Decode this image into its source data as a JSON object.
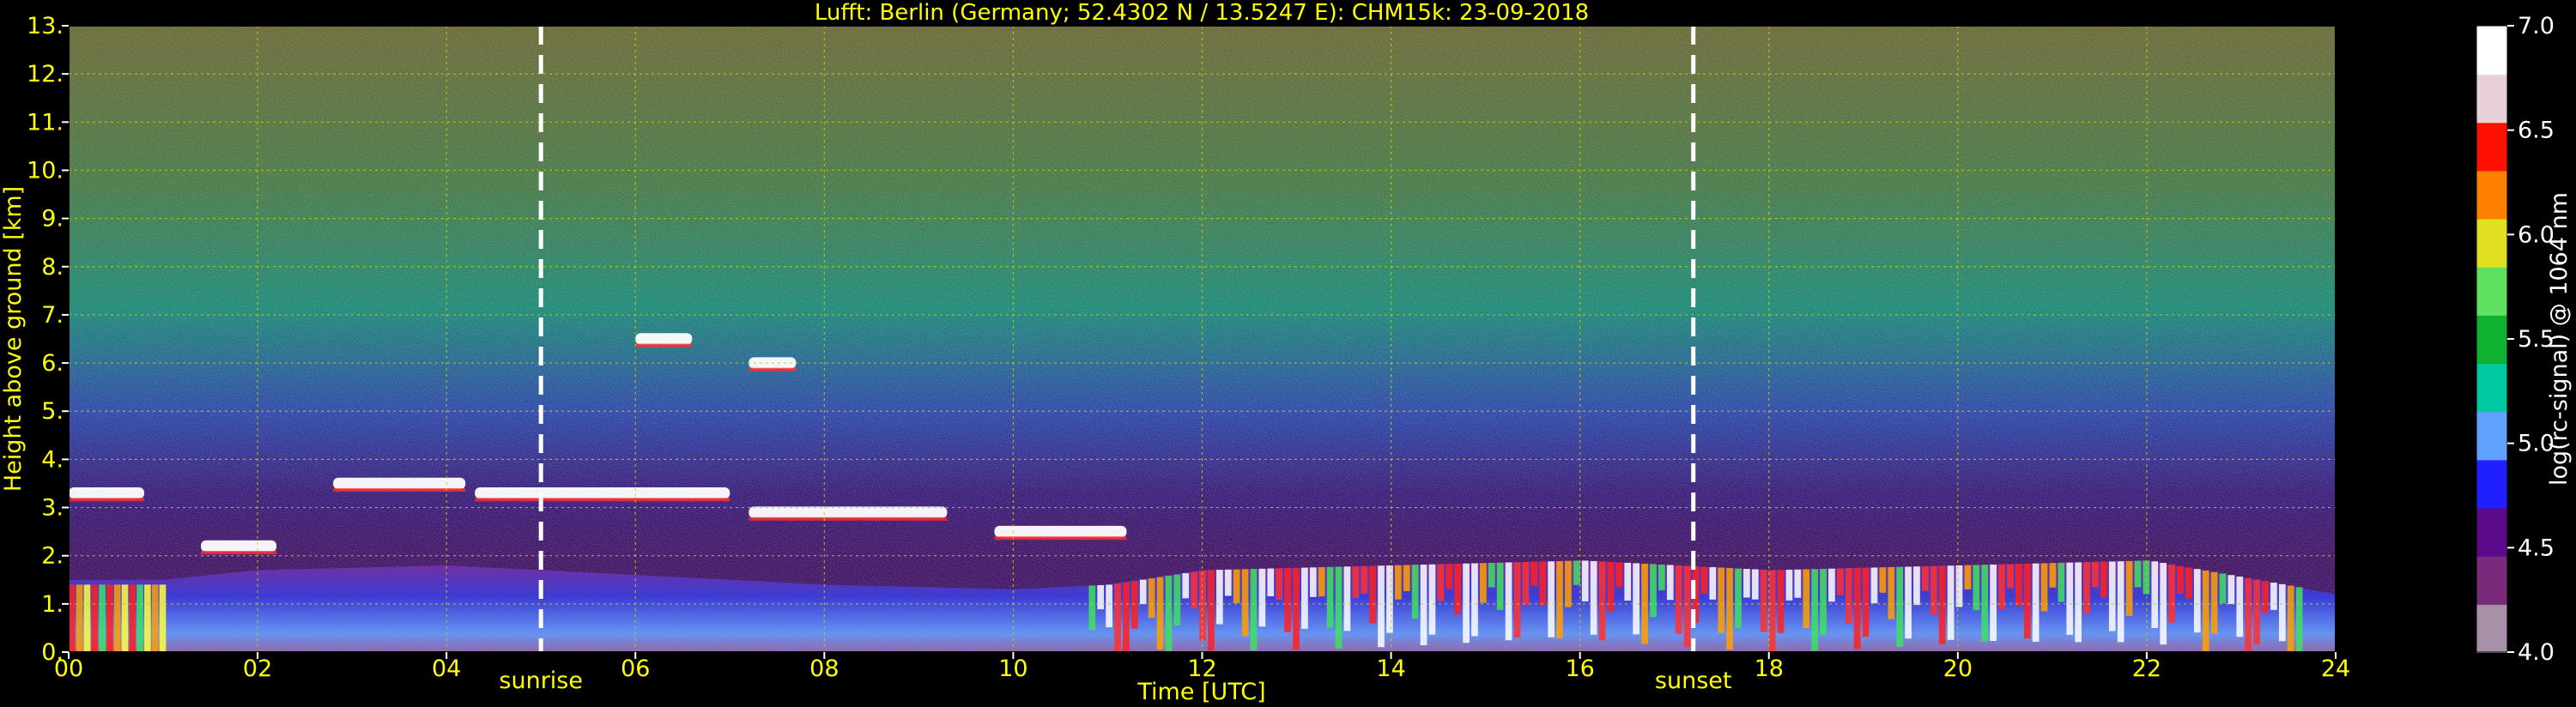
{
  "chart_data": {
    "type": "heatmap",
    "title": "Lufft: Berlin (Germany; 52.4302 N / 13.5247 E):    CHM15k: 23-09-2018",
    "xlabel": "Time [UTC]",
    "ylabel": "Height above ground [km]",
    "xlim": [
      0,
      24
    ],
    "ylim": [
      0,
      13
    ],
    "x_ticks": [
      "00",
      "02",
      "04",
      "06",
      "08",
      "10",
      "12",
      "14",
      "16",
      "18",
      "20",
      "22",
      "24"
    ],
    "y_ticks": [
      "0.",
      "1.",
      "2.",
      "3.",
      "4.",
      "5.",
      "6.",
      "7.",
      "8.",
      "9.",
      "10.",
      "11.",
      "12.",
      "13."
    ],
    "grid": true,
    "colorbar": {
      "label": "log(rc-signal) @ 1064 nm",
      "range": [
        4.0,
        7.0
      ],
      "ticks": [
        "4.0",
        "4.5",
        "5.0",
        "5.5",
        "6.0",
        "6.5",
        "7.0"
      ],
      "colors": [
        "#a890a8",
        "#7a2a7a",
        "#5a0a8a",
        "#2020ff",
        "#60a0ff",
        "#00c8a0",
        "#10b030",
        "#60e060",
        "#e0e020",
        "#ff8000",
        "#ff1000",
        "#e8d0d8",
        "#ffffff"
      ]
    },
    "annotations": [
      {
        "text": "sunrise",
        "x": 5.0
      },
      {
        "text": "sunset",
        "x": 17.2
      }
    ],
    "boundary_layer_top_km": [
      {
        "x": 0.0,
        "y": 1.5
      },
      {
        "x": 1.0,
        "y": 1.5
      },
      {
        "x": 2.0,
        "y": 1.7
      },
      {
        "x": 4.0,
        "y": 1.8
      },
      {
        "x": 6.0,
        "y": 1.6
      },
      {
        "x": 8.0,
        "y": 1.4
      },
      {
        "x": 10.0,
        "y": 1.3
      },
      {
        "x": 11.0,
        "y": 1.4
      },
      {
        "x": 12.0,
        "y": 1.7
      },
      {
        "x": 14.0,
        "y": 1.8
      },
      {
        "x": 16.0,
        "y": 1.9
      },
      {
        "x": 18.0,
        "y": 1.7
      },
      {
        "x": 20.0,
        "y": 1.8
      },
      {
        "x": 22.0,
        "y": 1.9
      },
      {
        "x": 24.0,
        "y": 1.2
      }
    ],
    "cloud_layers": [
      {
        "x_start": 0.0,
        "x_end": 0.8,
        "y": 3.3
      },
      {
        "x_start": 1.4,
        "x_end": 2.2,
        "y": 2.2
      },
      {
        "x_start": 2.8,
        "x_end": 4.2,
        "y": 3.5
      },
      {
        "x_start": 4.3,
        "x_end": 7.0,
        "y": 3.3
      },
      {
        "x_start": 7.2,
        "x_end": 9.3,
        "y": 2.9
      },
      {
        "x_start": 9.8,
        "x_end": 11.2,
        "y": 2.5
      },
      {
        "x_start": 6.0,
        "x_end": 6.6,
        "y": 6.5
      },
      {
        "x_start": 7.2,
        "x_end": 7.7,
        "y": 6.0
      }
    ]
  }
}
